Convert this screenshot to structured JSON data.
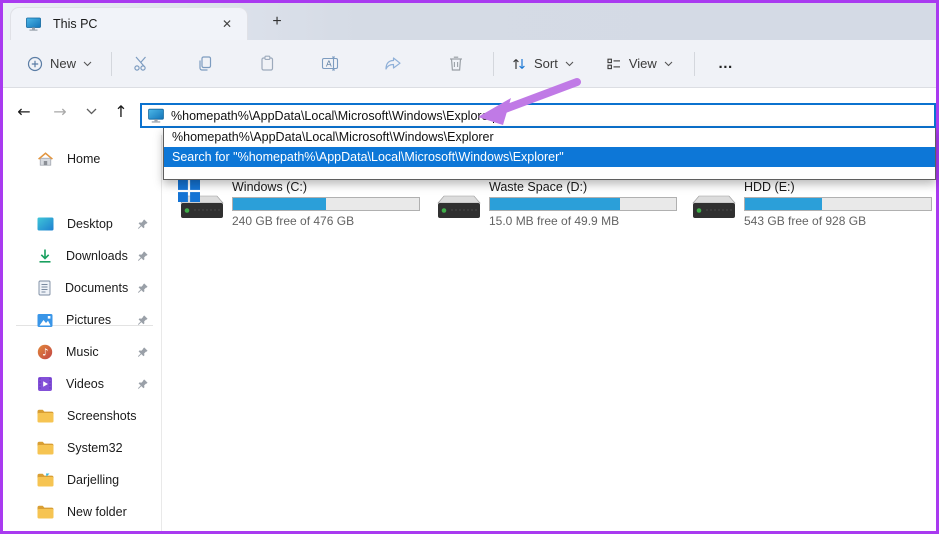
{
  "window": {
    "tab_title": "This PC"
  },
  "toolbar": {
    "new_label": "New",
    "sort_label": "Sort",
    "view_label": "View",
    "more_label": "…"
  },
  "navigation": {
    "back": "←",
    "forward": "→",
    "up": "↑"
  },
  "address_bar": {
    "value": "%homepath%\\AppData\\Local\\Microsoft\\Windows\\Explorer"
  },
  "suggestions": {
    "path_row": "%homepath%\\AppData\\Local\\Microsoft\\Windows\\Explorer",
    "search_row": "Search for \"%homepath%\\AppData\\Local\\Microsoft\\Windows\\Explorer\""
  },
  "sidebar": {
    "items": [
      {
        "label": "Home",
        "icon": "home-icon",
        "pinned": false
      },
      {
        "label": "Desktop",
        "icon": "desktop-icon",
        "pinned": true
      },
      {
        "label": "Downloads",
        "icon": "downloads-icon",
        "pinned": true
      },
      {
        "label": "Documents",
        "icon": "documents-icon",
        "pinned": true
      },
      {
        "label": "Pictures",
        "icon": "pictures-icon",
        "pinned": true
      },
      {
        "label": "Music",
        "icon": "music-icon",
        "pinned": true
      },
      {
        "label": "Videos",
        "icon": "videos-icon",
        "pinned": true
      },
      {
        "label": "Screenshots",
        "icon": "folder-icon",
        "pinned": false
      },
      {
        "label": "System32",
        "icon": "folder-icon",
        "pinned": false
      },
      {
        "label": "Darjelling",
        "icon": "folder-icon",
        "pinned": false
      },
      {
        "label": "New folder",
        "icon": "folder-icon",
        "pinned": false
      }
    ]
  },
  "drives": [
    {
      "name": "Windows (C:)",
      "free": "240 GB free of 476 GB",
      "used_percent": 50,
      "has_windows_logo": true
    },
    {
      "name": "Waste Space (D:)",
      "free": "15.0 MB free of 49.9 MB",
      "used_percent": 70,
      "has_windows_logo": false
    },
    {
      "name": "HDD (E:)",
      "free": "543 GB free of 928 GB",
      "used_percent": 41.5,
      "has_windows_logo": false
    }
  ],
  "icons": {
    "close": "✕",
    "new_tab": "+",
    "more": "…"
  },
  "colors": {
    "accent_blue": "#0d77d7",
    "address_focus_border": "#0b72cf",
    "meter_fill": "#2b9fd9",
    "annotation_border": "#a93af0",
    "annotation_arrow": "#c07ae6",
    "titlebar": "#d5dbe5",
    "toolbar_bg": "#f0f2f7"
  }
}
